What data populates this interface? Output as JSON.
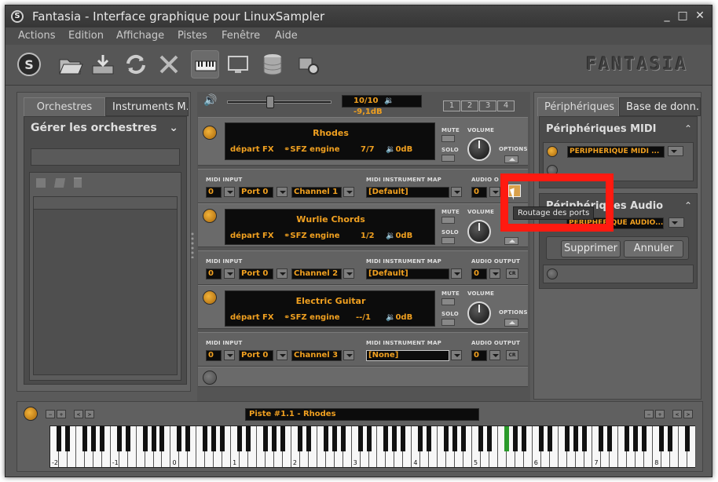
{
  "window": {
    "app_glyph": "S",
    "title": "Fantasia - Interface graphique pour LinuxSampler",
    "minimize_label": "_",
    "maximize_label": "□",
    "close_label": "✕"
  },
  "menu": [
    "Actions",
    "Edition",
    "Affichage",
    "Pistes",
    "Fenêtre",
    "Aide"
  ],
  "toolbar": {
    "brand": "FANTASIA",
    "icons": [
      "fantasia-logo-icon",
      "open-folder-icon",
      "save-icon",
      "refresh-icon",
      "tools-icon",
      "keyboard-icon",
      "monitor-icon",
      "database-icon",
      "settings-gear-icon"
    ]
  },
  "left_panel": {
    "tabs": [
      "Orchestres",
      "Instruments M..."
    ],
    "selector_label": "Gérer les orchestres"
  },
  "volume_bar": {
    "value_text": "10/10",
    "db_text": "-9,1dB",
    "pages": [
      "1",
      "2",
      "3",
      "4"
    ],
    "level": 0.4
  },
  "channels": [
    {
      "name": "Rhodes",
      "fx": "départ FX",
      "engine": "SFZ engine",
      "voices": "7/7",
      "db": "0dB",
      "mute": "MUTE",
      "solo": "SOLO",
      "volume": "VOLUME",
      "options": "OPTIONS",
      "midi_input_label": "MIDI INPUT",
      "midi_input_device": "0",
      "midi_port": "Port 0",
      "midi_channel": "Channel 1",
      "map_label": "MIDI INSTRUMENT MAP",
      "map_value": "[Default]",
      "audio_label": "AUDIO OUTPUT",
      "audio_device": "0",
      "audio_button": ""
    },
    {
      "name": "Wurlie Chords",
      "fx": "départ FX",
      "engine": "SFZ engine",
      "voices": "1/2",
      "db": "0dB",
      "mute": "MUTE",
      "solo": "SOLO",
      "volume": "VOLUME",
      "options": "",
      "midi_input_label": "MIDI INPUT",
      "midi_input_device": "0",
      "midi_port": "Port 0",
      "midi_channel": "Channel 2",
      "map_label": "MIDI INSTRUMENT MAP",
      "map_value": "[Default]",
      "audio_label": "AUDIO OUTPUT",
      "audio_device": "0",
      "audio_button": "CR"
    },
    {
      "name": "Electric Guitar",
      "fx": "départ FX",
      "engine": "SFZ engine",
      "voices": "--/1",
      "db": "0dB",
      "mute": "MUTE",
      "solo": "SOLO",
      "volume": "VOLUME",
      "options": "OPTIONS",
      "midi_input_label": "MIDI INPUT",
      "midi_input_device": "0",
      "midi_port": "Port 0",
      "midi_channel": "Channel 3",
      "map_label": "MIDI INSTRUMENT MAP",
      "map_value": "[None]",
      "audio_label": "AUDIO OUTPUT",
      "audio_device": "0",
      "audio_button": "CR"
    }
  ],
  "first_audio_label_visible": "AUDIO O",
  "right_panel": {
    "tabs": [
      "Périphériques",
      "Base de donn..."
    ],
    "midi_header": "Périphériques MIDI",
    "midi_device": "PERIPHERIQUE MIDI ...",
    "audio_header": "Périphériques Audio",
    "audio_device": "PERIPHERIQUE AUDIO...",
    "delete_button": "Supprimer",
    "cancel_button": "Annuler"
  },
  "tooltip": "Routage des ports",
  "keyboard": {
    "track": "Piste #1.1 - Rhodes",
    "octave_labels": [
      "-2",
      "-1",
      "0",
      "1",
      "2",
      "3",
      "4",
      "5",
      "6",
      "7",
      "8"
    ],
    "pressed_key": "F3"
  },
  "colors": {
    "accent_orange": "#f0a020",
    "highlight_red": "#ff1a10",
    "pressed_key_green": "#2a9a2a"
  }
}
